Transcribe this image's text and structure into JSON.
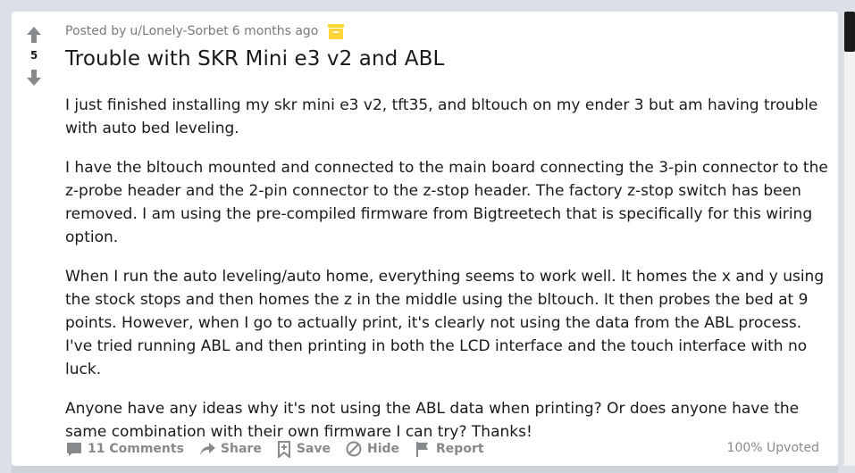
{
  "post": {
    "score": "5",
    "meta_prefix": "Posted by",
    "author": "u/Lonely-Sorbet",
    "time": "6 months ago",
    "title": "Trouble with SKR Mini e3 v2 and ABL",
    "paragraphs": [
      "I just finished installing my skr mini e3 v2, tft35, and bltouch on my ender 3 but am having trouble with auto bed leveling.",
      "I have the bltouch mounted and connected to the main board connecting the 3-pin connector to the z-probe header and the 2-pin connector to the z-stop header. The factory z-stop switch has been removed. I am using the pre-compiled firmware from Bigtreetech that is specifically for this wiring option.",
      "When I run the auto leveling/auto home, everything seems to work well. It homes the x and y using the stock stops and then homes the z in the middle using the bltouch. It then probes the bed at 9 points. However, when I go to actually print, it's clearly not using the data from the ABL process. I've tried running ABL and then printing in both the LCD interface and the touch interface with no luck.",
      "Anyone have any ideas why it's not using the ABL data when printing? Or does anyone have the same combination with their own firmware I can try? Thanks!"
    ]
  },
  "actions": {
    "comments": "11 Comments",
    "share": "Share",
    "save": "Save",
    "hide": "Hide",
    "report": "Report"
  },
  "upvoted": "100% Upvoted",
  "icons": {
    "upvote": "arrow-up-icon",
    "downvote": "arrow-down-icon",
    "archive": "archive-box-icon",
    "comments": "comment-bubble-icon",
    "share": "share-arrow-icon",
    "save": "bookmark-plus-icon",
    "hide": "hide-circle-slash-icon",
    "report": "flag-icon"
  },
  "colors": {
    "background": "#dae0e6",
    "card": "#ffffff",
    "text": "#1a1a1b",
    "muted": "#787c7e",
    "archive_yellow": "#ffd635"
  }
}
